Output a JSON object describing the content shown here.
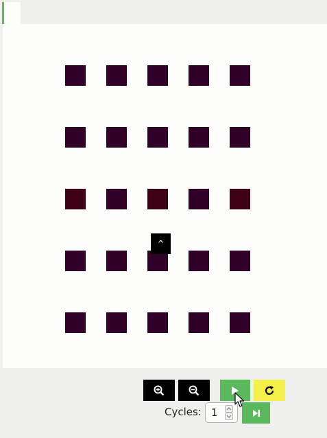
{
  "toolbar": {
    "zoom_in_icon": "zoom-in-icon",
    "zoom_out_icon": "zoom-out-icon",
    "play_icon": "play-icon",
    "reset_icon": "reset-icon",
    "step_icon": "step-forward-icon"
  },
  "cycles": {
    "label": "Cycles:",
    "value": "1"
  },
  "grid": {
    "tooltip_glyph": "^",
    "cell_color": "#310029",
    "highlight_color": "#3d0015"
  },
  "colors": {
    "play_button": "#5cb85c",
    "reset_button": "#f3f04a",
    "zoom_button": "#000000",
    "tab_accent": "#5cb85c"
  }
}
